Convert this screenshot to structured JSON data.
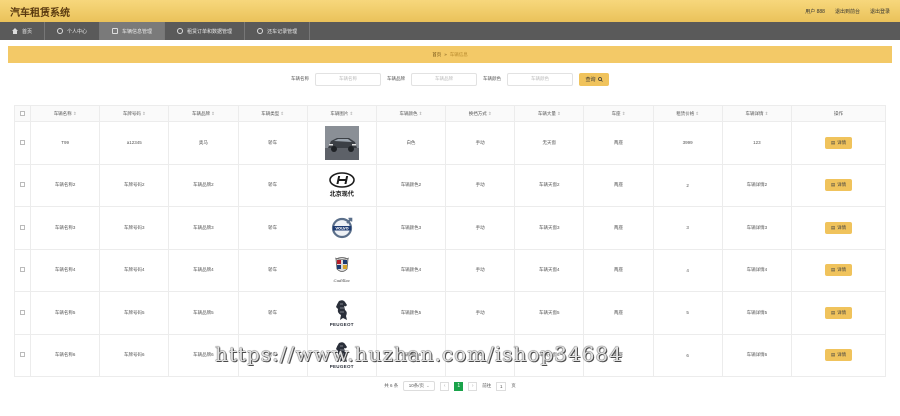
{
  "app": {
    "title": "汽车租赁系统"
  },
  "topbar": {
    "user": "用户 888",
    "back_home": "退出到前台",
    "logout": "退出登录"
  },
  "nav": [
    {
      "label": "首页",
      "icon": "home-icon"
    },
    {
      "label": "个人中心",
      "icon": "person-icon"
    },
    {
      "label": "车辆信息管理",
      "icon": "list-icon"
    },
    {
      "label": "租赁订单和数据管理",
      "icon": "order-icon"
    },
    {
      "label": "还车记录管理",
      "icon": "record-icon"
    }
  ],
  "breadcrumb": {
    "home": "首页",
    "sep": "»",
    "current": "车辆信息"
  },
  "search": {
    "name_label": "车辆名称",
    "name_placeholder": "车辆名称",
    "brand_label": "车辆品牌",
    "brand_placeholder": "车辆品牌",
    "color_label": "车辆颜色",
    "color_placeholder": "车辆颜色",
    "button": "查询"
  },
  "table": {
    "headers": [
      "车辆名称",
      "车牌号码",
      "车辆品牌",
      "车辆类型",
      "车辆图片",
      "车辆颜色",
      "换挡方式",
      "车辆大量",
      "车座",
      "租赁价格",
      "车辆详情",
      "操作"
    ],
    "rows": [
      {
        "name": "T99",
        "plate": "a12345",
        "brand": "奥马",
        "type": "轿车",
        "image": "photo",
        "color": "白色",
        "gear": "手动",
        "volume": "无天窗",
        "seat": "两座",
        "price": "3999",
        "detail": "123"
      },
      {
        "name": "车辆名称2",
        "plate": "车牌号码2",
        "brand": "车辆品牌2",
        "type": "轿车",
        "image": "hyundai",
        "color": "车辆颜色2",
        "gear": "手动",
        "volume": "车辆天窗2",
        "seat": "两座",
        "price": "2",
        "detail": "车辆详情2"
      },
      {
        "name": "车辆名称3",
        "plate": "车牌号码3",
        "brand": "车辆品牌3",
        "type": "轿车",
        "image": "volvo",
        "color": "车辆颜色3",
        "gear": "手动",
        "volume": "车辆天窗3",
        "seat": "两座",
        "price": "3",
        "detail": "车辆详情3"
      },
      {
        "name": "车辆名称4",
        "plate": "车牌号码4",
        "brand": "车辆品牌4",
        "type": "轿车",
        "image": "cadillac",
        "color": "车辆颜色4",
        "gear": "手动",
        "volume": "车辆天窗4",
        "seat": "两座",
        "price": "4",
        "detail": "车辆详情4"
      },
      {
        "name": "车辆名称5",
        "plate": "车牌号码5",
        "brand": "车辆品牌5",
        "type": "轿车",
        "image": "peugeot",
        "color": "车辆颜色5",
        "gear": "手动",
        "volume": "车辆天窗5",
        "seat": "两座",
        "price": "5",
        "detail": "车辆详情5"
      },
      {
        "name": "车辆名称6",
        "plate": "车牌号码6",
        "brand": "车辆品牌6",
        "type": "轿车",
        "image": "peugeot",
        "color": "车辆颜色6",
        "gear": "手动",
        "volume": "车辆天窗6",
        "seat": "两座",
        "price": "6",
        "detail": "车辆详情6"
      }
    ],
    "action_label": "详情"
  },
  "logos": {
    "hyundai": "北京现代",
    "peugeot": "PEUGEOT",
    "cadillac": "Cadillac"
  },
  "pager": {
    "total": "共 6 条",
    "per_page": "10条/页",
    "prev": "‹",
    "current": "1",
    "next": "›",
    "goto_label": "前往",
    "goto_value": "1",
    "page_unit": "页"
  },
  "watermark": "https://www.huzhan.com/ishop34684",
  "colors": {
    "accent": "#f0c35c",
    "topbar": "#eac25a",
    "nav": "#5a5a5a",
    "pager_active": "#1aa34a"
  }
}
